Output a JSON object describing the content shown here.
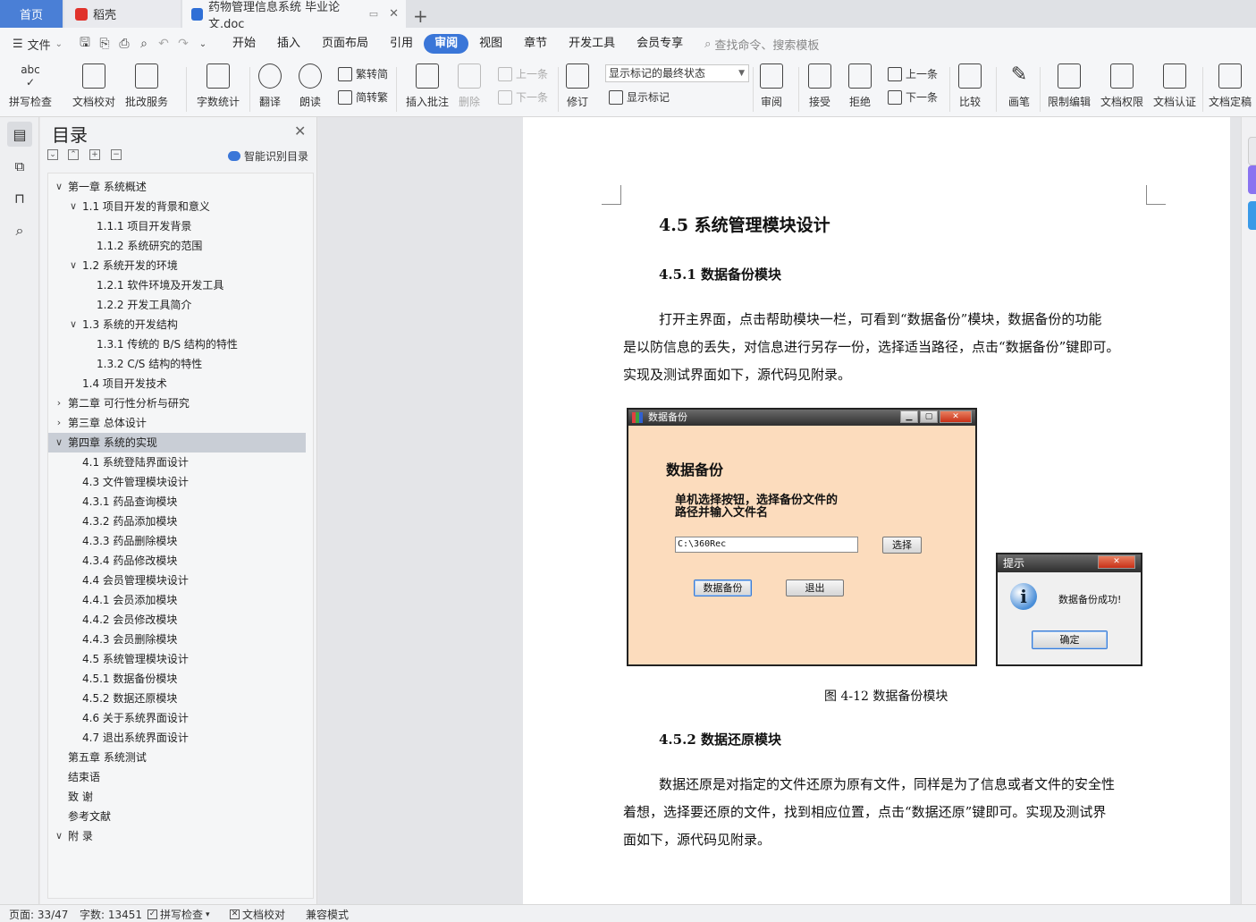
{
  "tabs": {
    "home": "首页",
    "daoke": "稻壳",
    "doc": "药物管理信息系统 毕业论文.doc",
    "new": "+"
  },
  "menubar": {
    "file": "文件",
    "items": [
      "开始",
      "插入",
      "页面布局",
      "引用",
      "审阅",
      "视图",
      "章节",
      "开发工具",
      "会员专享"
    ],
    "active": "审阅",
    "search": "查找命令、搜索模板"
  },
  "ribbon": {
    "spellcheck": "拼写检查",
    "doc_proof": "文档校对",
    "review_service": "批改服务",
    "word_count": "字数统计",
    "translate": "翻译",
    "read_aloud": "朗读",
    "to_traditional": "繁转简",
    "to_simplified": "简转繁",
    "insert_comment": "插入批注",
    "delete": "删除",
    "prev_comment": "上一条",
    "next_comment": "下一条",
    "track_changes": "修订",
    "markup_state": "显示标记的最终状态",
    "show_markup": "显示标记",
    "review_pane": "审阅",
    "accept": "接受",
    "reject": "拒绝",
    "prev_change": "上一条",
    "next_change": "下一条",
    "compare": "比较",
    "ink": "画笔",
    "restrict_edit": "限制编辑",
    "doc_permission": "文档权限",
    "doc_certify": "文档认证",
    "doc_finalize": "文档定稿"
  },
  "toc": {
    "title": "目录",
    "smart": "智能识别目录",
    "items": [
      {
        "text": "第一章  系统概述",
        "level": 0,
        "arrow": "down"
      },
      {
        "text": "1.1  项目开发的背景和意义",
        "level": 1,
        "arrow": "down"
      },
      {
        "text": "1.1.1  项目开发背景",
        "level": 2,
        "arrow": ""
      },
      {
        "text": "1.1.2  系统研究的范围",
        "level": 2,
        "arrow": ""
      },
      {
        "text": "1.2  系统开发的环境",
        "level": 1,
        "arrow": "down"
      },
      {
        "text": "1.2.1  软件环境及开发工具",
        "level": 2,
        "arrow": ""
      },
      {
        "text": "1.2.2  开发工具简介",
        "level": 2,
        "arrow": ""
      },
      {
        "text": "1.3  系统的开发结构",
        "level": 1,
        "arrow": "down"
      },
      {
        "text": "1.3.1  传统的 B/S 结构的特性",
        "level": 2,
        "arrow": ""
      },
      {
        "text": "1.3.2 C/S  结构的特性",
        "level": 2,
        "arrow": ""
      },
      {
        "text": "1.4  项目开发技术",
        "level": 1,
        "arrow": ""
      },
      {
        "text": "第二章  可行性分析与研究",
        "level": 0,
        "arrow": "right"
      },
      {
        "text": "第三章  总体设计",
        "level": 0,
        "arrow": "right"
      },
      {
        "text": "第四章  系统的实现",
        "level": 0,
        "arrow": "down",
        "selected": true
      },
      {
        "text": "4.1  系统登陆界面设计",
        "level": 1,
        "arrow": ""
      },
      {
        "text": "4.3  文件管理模块设计",
        "level": 1,
        "arrow": ""
      },
      {
        "text": "4.3.1 药品查询模块",
        "level": 1,
        "arrow": ""
      },
      {
        "text": "4.3.2  药品添加模块",
        "level": 1,
        "arrow": ""
      },
      {
        "text": "4.3.3 药品删除模块",
        "level": 1,
        "arrow": ""
      },
      {
        "text": "4.3.4 药品修改模块",
        "level": 1,
        "arrow": ""
      },
      {
        "text": "4.4 会员管理模块设计",
        "level": 1,
        "arrow": ""
      },
      {
        "text": "4.4.1 会员添加模块",
        "level": 1,
        "arrow": ""
      },
      {
        "text": "4.4.2 会员修改模块",
        "level": 1,
        "arrow": ""
      },
      {
        "text": "4.4.3 会员删除模块",
        "level": 1,
        "arrow": ""
      },
      {
        "text": "4.5  系统管理模块设计",
        "level": 1,
        "arrow": ""
      },
      {
        "text": "4.5.1  数据备份模块",
        "level": 1,
        "arrow": ""
      },
      {
        "text": "4.5.2  数据还原模块",
        "level": 1,
        "arrow": ""
      },
      {
        "text": "4.6  关于系统界面设计",
        "level": 1,
        "arrow": ""
      },
      {
        "text": "4.7  退出系统界面设计",
        "level": 1,
        "arrow": ""
      },
      {
        "text": "第五章  系统测试",
        "level": 0,
        "arrow": ""
      },
      {
        "text": "结束语",
        "level": 0,
        "arrow": ""
      },
      {
        "text": "致    谢",
        "level": 0,
        "arrow": ""
      },
      {
        "text": "参考文献",
        "level": 0,
        "arrow": ""
      },
      {
        "text": "附    录",
        "level": 0,
        "arrow": "down"
      }
    ]
  },
  "document": {
    "h_45": "4.5  系统管理模块设计",
    "h_451": "4.5.1 数据备份模块",
    "p_451": [
      "打开主界面，点击帮助模块一栏，可看到“数据备份”模块，数据备份的功能",
      "是以防信息的丢失，对信息进行另存一份，选择适当路径，点击“数据备份”键即可。",
      "实现及测试界面如下，源代码见附录。"
    ],
    "caption": "图 4-12 数据备份模块",
    "h_452": "4.5.2 数据还原模块",
    "p_452": [
      "数据还原是对指定的文件还原为原有文件，同样是为了信息或者文件的安全性",
      "着想，选择要还原的文件，找到相应位置，点击“数据还原”键即可。实现及测试界",
      "面如下，源代码见附录。"
    ]
  },
  "backup_window": {
    "title": "数据备份",
    "heading": "数据备份",
    "instruction_line1": "单机选择按钮，选择备份文件的",
    "instruction_line2": "路径并输入文件名",
    "path_value": "C:\\360Rec",
    "choose": "选择",
    "backup": "数据备份",
    "exit": "退出"
  },
  "message_box": {
    "title": "提示",
    "message": "数据备份成功!",
    "ok": "确定"
  },
  "status": {
    "page": "页面: 33/47",
    "words": "字数: 13451",
    "spellcheck": "拼写检查",
    "proof": "文档校对",
    "compat": "兼容模式"
  }
}
